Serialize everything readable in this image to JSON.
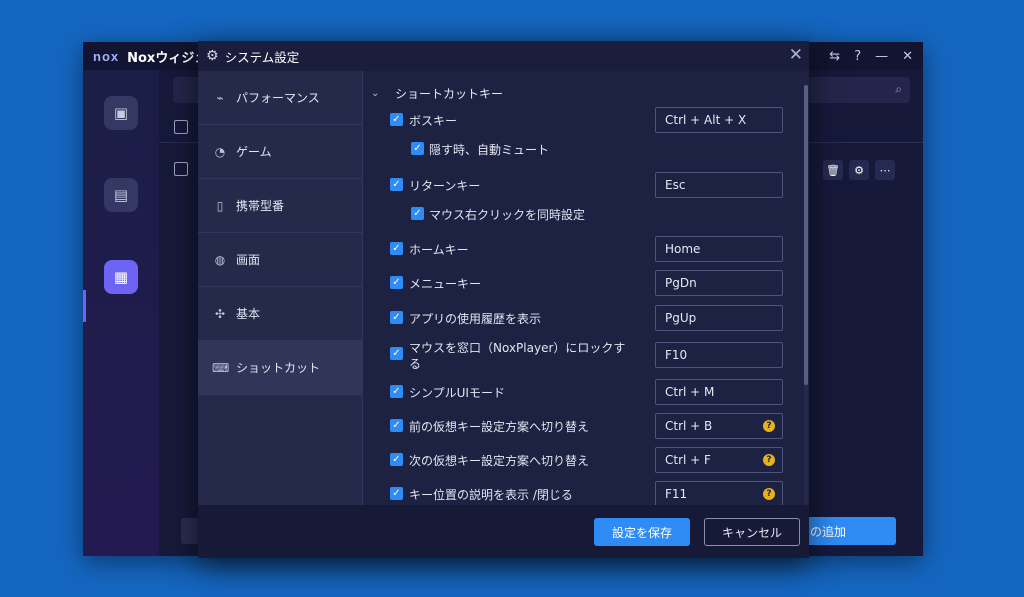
{
  "app": {
    "logo": "nox",
    "title": "Noxウィジェ",
    "titlebar_icons": [
      "window-switch-icon",
      "help-icon",
      "minimize-icon",
      "close-icon"
    ],
    "add_button_label": "の追加"
  },
  "dialog": {
    "title": "システム設定",
    "nav": [
      {
        "label": "パフォーマンス",
        "icon": "pulse-icon",
        "active": false
      },
      {
        "label": "ゲーム",
        "icon": "gamepad-icon",
        "active": false
      },
      {
        "label": "携帯型番",
        "icon": "phone-icon",
        "active": false
      },
      {
        "label": "画面",
        "icon": "palette-icon",
        "active": false
      },
      {
        "label": "基本",
        "icon": "puzzle-icon",
        "active": false
      },
      {
        "label": "ショットカット",
        "icon": "keyboard-icon",
        "active": true
      }
    ],
    "section_title": "ショートカットキー",
    "options": [
      {
        "label": "ボスキー",
        "checked": true,
        "key": "Ctrl + Alt + X",
        "help": false
      },
      {
        "label": "隠す時、自動ミュート",
        "checked": true,
        "sub": true
      },
      {
        "label": "リターンキー",
        "checked": true,
        "key": "Esc",
        "help": false
      },
      {
        "label": "マウス右クリックを同時設定",
        "checked": true,
        "sub": true
      },
      {
        "label": "ホームキー",
        "checked": true,
        "key": "Home",
        "help": false
      },
      {
        "label": "メニューキー",
        "checked": true,
        "key": "PgDn",
        "help": false
      },
      {
        "label": "アプリの使用履歴を表示",
        "checked": true,
        "key": "PgUp",
        "help": false
      },
      {
        "label": "マウスを窓口（NoxPlayer）にロックする",
        "checked": true,
        "key": "F10",
        "help": false
      },
      {
        "label": "シンプルUIモード",
        "checked": true,
        "key": "Ctrl + M",
        "help": false
      },
      {
        "label": "前の仮想キー設定方案へ切り替え",
        "checked": true,
        "key": "Ctrl + B",
        "help": true
      },
      {
        "label": "次の仮想キー設定方案へ切り替え",
        "checked": true,
        "key": "Ctrl + F",
        "help": true
      },
      {
        "label": "キー位置の説明を表示 /閉じる",
        "checked": true,
        "key": "F11",
        "help": true
      }
    ],
    "save_label": "設定を保存",
    "cancel_label": "キャンセル"
  },
  "colors": {
    "accent": "#2f8cf6",
    "dialog_bg": "#1d2142",
    "nav_bg": "#252a4b",
    "help_badge": "#e3b21e",
    "desktop": "#1566c0"
  }
}
